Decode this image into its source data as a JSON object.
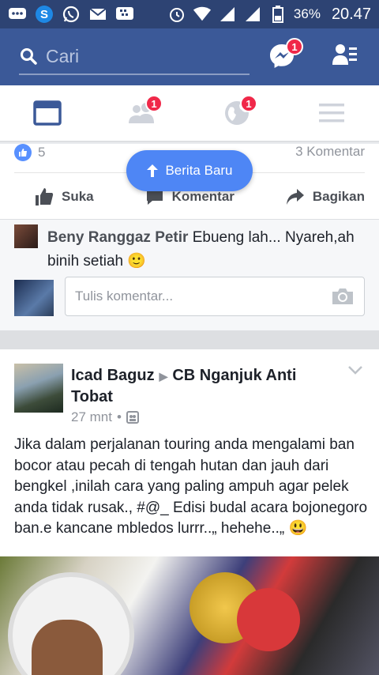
{
  "status_bar": {
    "battery": "36%",
    "time": "20.47"
  },
  "search": {
    "placeholder": "Cari"
  },
  "header": {
    "messenger_badge": "1"
  },
  "tabs": {
    "friends_badge": "1",
    "notifications_badge": "1"
  },
  "post1": {
    "like_count": "5",
    "comment_count": "3 Komentar",
    "actions": {
      "like": "Suka",
      "comment": "Komentar",
      "share": "Bagikan"
    },
    "new_stories": "Berita Baru",
    "comment": {
      "author": "Beny Ranggaz Petir",
      "text": "Ebueng lah... Nyareh,ah binih setiah 🙂"
    },
    "write_placeholder": "Tulis komentar..."
  },
  "post2": {
    "author": "Icad Baguz",
    "group": "CB Nganjuk Anti Tobat",
    "time": "27 mnt",
    "body": "Jika dalam perjalanan touring anda mengalami ban bocor atau pecah di tengah hutan dan jauh dari bengkel ,inilah cara yang paling ampuh agar pelek anda tidak rusak., #@_   Edisi budal acara bojonegoro ban.e kancane mbledos lurrr..„  hehehe..„  😃"
  },
  "colors": {
    "brand": "#3b5998",
    "status_bar": "#2d4373",
    "badge": "#f02849",
    "new_stories_button": "#4e86f5"
  }
}
